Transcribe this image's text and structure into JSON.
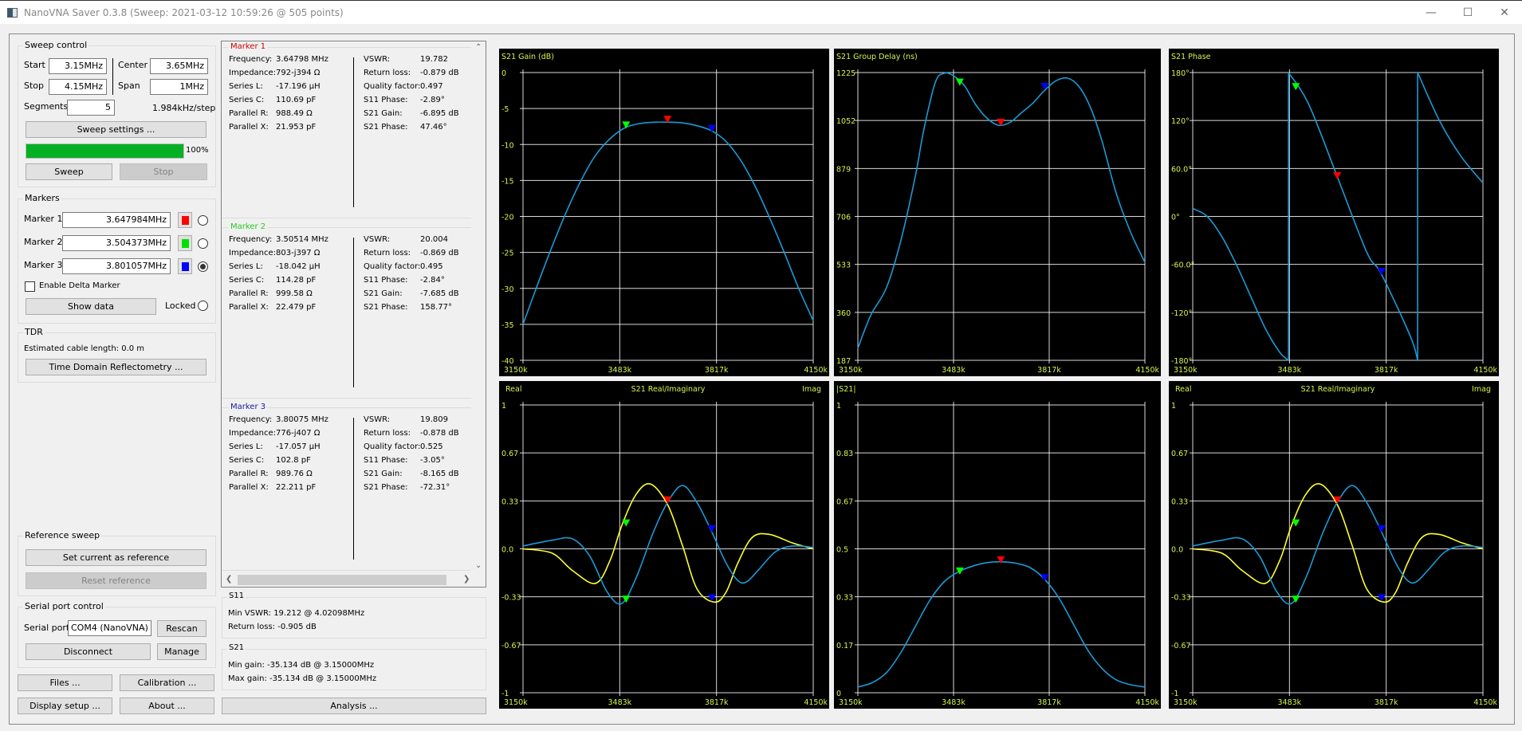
{
  "window": {
    "title": "NanoVNA Saver 0.3.8 (Sweep: 2021-03-12 10:59:26 @ 505 points)",
    "controls": {
      "minimize": "—",
      "maximize": "☐",
      "close": "✕"
    }
  },
  "sweep_control": {
    "title": "Sweep control",
    "start_label": "Start",
    "start_value": "3.15MHz",
    "stop_label": "Stop",
    "stop_value": "4.15MHz",
    "center_label": "Center",
    "center_value": "3.65MHz",
    "span_label": "Span",
    "span_value": "1MHz",
    "segments_label": "Segments",
    "segments_value": "5",
    "step_text": "1.984kHz/step",
    "settings_button": "Sweep settings ...",
    "progress_percent": 100,
    "progress_text": "100%",
    "sweep_button": "Sweep",
    "stop_button": "Stop"
  },
  "markers": {
    "title": "Markers",
    "items": [
      {
        "label": "Marker 1",
        "value": "3.647984MHz",
        "color": "#ff0000",
        "selected": false
      },
      {
        "label": "Marker 2",
        "value": "3.504373MHz",
        "color": "#00e000",
        "selected": false
      },
      {
        "label": "Marker 3",
        "value": "3.801057MHz",
        "color": "#0000ff",
        "selected": true
      }
    ],
    "delta_label": "Enable Delta Marker",
    "show_data_button": "Show data",
    "locked_label": "Locked"
  },
  "tdr": {
    "title": "TDR",
    "cable_length_text": "Estimated cable length:  0.0 m",
    "tdr_button": "Time Domain Reflectometry ..."
  },
  "reference_sweep": {
    "title": "Reference sweep",
    "set_button": "Set current as reference",
    "reset_button": "Reset reference"
  },
  "serial_port": {
    "title": "Serial port control",
    "port_label": "Serial port",
    "port_value": "COM4 (NanoVNA)",
    "rescan_button": "Rescan",
    "disconnect_button": "Disconnect",
    "manage_button": "Manage"
  },
  "bottom_buttons": {
    "files": "Files ...",
    "calibration": "Calibration ...",
    "display_setup": "Display setup ...",
    "about": "About ...",
    "analysis": "Analysis ..."
  },
  "marker_details": [
    {
      "title": "Marker 1",
      "color": "#cc0000",
      "left": [
        [
          "Frequency:",
          "3.64798 MHz"
        ],
        [
          "Impedance:",
          "792-j394 Ω"
        ],
        [
          "Series L:",
          "-17.196 µH"
        ],
        [
          "Series C:",
          "110.69 pF"
        ],
        [
          "Parallel R:",
          "988.49 Ω"
        ],
        [
          "Parallel X:",
          "21.953 pF"
        ]
      ],
      "right": [
        [
          "VSWR:",
          "19.782"
        ],
        [
          "Return loss:",
          "-0.879 dB"
        ],
        [
          "Quality factor:",
          "0.497"
        ],
        [
          "S11 Phase:",
          "-2.89°"
        ],
        [
          "S21 Gain:",
          "-6.895 dB"
        ],
        [
          "S21 Phase:",
          "47.46°"
        ]
      ]
    },
    {
      "title": "Marker 2",
      "color": "#22cc22",
      "left": [
        [
          "Frequency:",
          "3.50514 MHz"
        ],
        [
          "Impedance:",
          "803-j397 Ω"
        ],
        [
          "Series L:",
          "-18.042 µH"
        ],
        [
          "Series C:",
          "114.28 pF"
        ],
        [
          "Parallel R:",
          "999.58 Ω"
        ],
        [
          "Parallel X:",
          "22.479 pF"
        ]
      ],
      "right": [
        [
          "VSWR:",
          "20.004"
        ],
        [
          "Return loss:",
          "-0.869 dB"
        ],
        [
          "Quality factor:",
          "0.495"
        ],
        [
          "S11 Phase:",
          "-2.84°"
        ],
        [
          "S21 Gain:",
          "-7.685 dB"
        ],
        [
          "S21 Phase:",
          "158.77°"
        ]
      ]
    },
    {
      "title": "Marker 3",
      "color": "#1a1aa0",
      "left": [
        [
          "Frequency:",
          "3.80075 MHz"
        ],
        [
          "Impedance:",
          "776-j407 Ω"
        ],
        [
          "Series L:",
          "-17.057 µH"
        ],
        [
          "Series C:",
          "102.8 pF"
        ],
        [
          "Parallel R:",
          "989.76 Ω"
        ],
        [
          "Parallel X:",
          "22.211 pF"
        ]
      ],
      "right": [
        [
          "VSWR:",
          "19.809"
        ],
        [
          "Return loss:",
          "-0.878 dB"
        ],
        [
          "Quality factor:",
          "0.525"
        ],
        [
          "S11 Phase:",
          "-3.05°"
        ],
        [
          "S21 Gain:",
          "-8.165 dB"
        ],
        [
          "S21 Phase:",
          "-72.31°"
        ]
      ]
    }
  ],
  "s11_summary": {
    "title": "S11",
    "min_vswr": "Min VSWR:    19.212 @ 4.02098MHz",
    "return_loss": "Return loss:  -0.905 dB"
  },
  "s21_summary": {
    "title": "S21",
    "min_gain": "Min gain:  -35.134 dB @ 3.15000MHz",
    "max_gain": "Max gain:  -35.134 dB @ 3.15000MHz"
  },
  "colors": {
    "trace": "#1a9ad6",
    "trace_imag": "#ffff30",
    "grid": "#ffffff",
    "chart_text": "#d2f54f",
    "chart_bg": "#000000",
    "marker1": "#ff0000",
    "marker2": "#00ff00",
    "marker3": "#0000ff"
  },
  "chart_data": [
    {
      "type": "line",
      "title": "S21 Gain (dB)",
      "ylabel": "",
      "xlabel": "",
      "x_ticks": [
        "3150k",
        "3483k",
        "3817k",
        "4150k"
      ],
      "xlim": [
        3150,
        4150
      ],
      "y_ticks": [
        "0",
        "-5",
        "-10",
        "-15",
        "-20",
        "-25",
        "-30",
        "-35",
        "-40"
      ],
      "ylim": [
        -40,
        0
      ],
      "series": [
        {
          "name": "S21 Gain",
          "color": "#1a9ad6",
          "x": [
            3150,
            3200,
            3250,
            3300,
            3350,
            3400,
            3450,
            3500,
            3550,
            3600,
            3650,
            3700,
            3750,
            3800,
            3850,
            3900,
            3950,
            4000,
            4050,
            4100,
            4150
          ],
          "y": [
            -35,
            -29.5,
            -24.2,
            -19.3,
            -15,
            -11.5,
            -9.2,
            -7.7,
            -7.1,
            -6.9,
            -6.9,
            -7.0,
            -7.4,
            -8.1,
            -9.6,
            -12.2,
            -15.8,
            -20.2,
            -25.0,
            -30.0,
            -34.5
          ]
        }
      ],
      "markers": [
        {
          "x": 3647.98,
          "y": -6.895,
          "color": "#ff0000"
        },
        {
          "x": 3505.14,
          "y": -7.685,
          "color": "#00ff00"
        },
        {
          "x": 3800.75,
          "y": -8.165,
          "color": "#0000ff"
        }
      ],
      "grid": true
    },
    {
      "type": "line",
      "title": "S21 Group Delay (ns)",
      "ylabel": "",
      "xlabel": "",
      "x_ticks": [
        "3150k",
        "3483k",
        "3817k",
        "4150k"
      ],
      "xlim": [
        3150,
        4150
      ],
      "y_ticks": [
        "1225",
        "1052",
        "879",
        "706",
        "533",
        "360",
        "187"
      ],
      "ylim": [
        187,
        1225
      ],
      "series": [
        {
          "name": "Group Delay",
          "color": "#1a9ad6",
          "x": [
            3150,
            3175,
            3200,
            3250,
            3300,
            3350,
            3380,
            3420,
            3450,
            3480,
            3520,
            3560,
            3600,
            3640,
            3680,
            3720,
            3760,
            3800,
            3840,
            3880,
            3920,
            3960,
            4000,
            4050,
            4100,
            4150
          ],
          "y": [
            230,
            300,
            360,
            450,
            620,
            850,
            1020,
            1190,
            1222,
            1215,
            1180,
            1110,
            1060,
            1035,
            1045,
            1080,
            1115,
            1160,
            1195,
            1205,
            1175,
            1100,
            980,
            790,
            650,
            540
          ]
        }
      ],
      "markers": [
        {
          "x": 3647.98,
          "y": 1035,
          "color": "#ff0000"
        },
        {
          "x": 3505.14,
          "y": 1180,
          "color": "#00ff00"
        },
        {
          "x": 3800.75,
          "y": 1165,
          "color": "#0000ff"
        }
      ],
      "grid": true
    },
    {
      "type": "line",
      "title": "S21 Phase",
      "ylabel": "",
      "xlabel": "",
      "x_ticks": [
        "3150k",
        "3483k",
        "3817k",
        "4150k"
      ],
      "xlim": [
        3150,
        4150
      ],
      "y_ticks": [
        "180°",
        "120°",
        "60.0°",
        "0°",
        "-60.0°",
        "-120°",
        "-180°"
      ],
      "ylim": [
        -180,
        180
      ],
      "series": [
        {
          "name": "S21 Phase",
          "color": "#1a9ad6",
          "segments": [
            {
              "x": [
                3150,
                3200,
                3250,
                3300,
                3350,
                3400,
                3450,
                3480
              ],
              "y": [
                10,
                0,
                -25,
                -60,
                -100,
                -140,
                -170,
                -180
              ]
            },
            {
              "x": [
                3480,
                3480
              ],
              "y": [
                -180,
                180
              ]
            },
            {
              "x": [
                3480,
                3550,
                3650,
                3750,
                3800,
                3900,
                3925
              ],
              "y": [
                180,
                140,
                48,
                -45,
                -72,
                -150,
                -180
              ]
            },
            {
              "x": [
                3925,
                3925
              ],
              "y": [
                -180,
                180
              ]
            },
            {
              "x": [
                3925,
                4000,
                4075,
                4150
              ],
              "y": [
                180,
                120,
                75,
                42
              ]
            }
          ]
        }
      ],
      "markers": [
        {
          "x": 3647.98,
          "y": 47.46,
          "color": "#ff0000"
        },
        {
          "x": 3505.14,
          "y": 158.77,
          "color": "#00ff00"
        },
        {
          "x": 3800.75,
          "y": -72.31,
          "color": "#0000ff"
        }
      ],
      "grid": true
    },
    {
      "type": "line",
      "title": "S21 Real/Imaginary",
      "ylabel": "Real",
      "ylabel_right": "Imag",
      "xlabel": "",
      "x_ticks": [
        "3150k",
        "3483k",
        "3817k",
        "4150k"
      ],
      "xlim": [
        3150,
        4150
      ],
      "y_ticks": [
        "1",
        "0.67",
        "0.33",
        "0.0",
        "-0.33",
        "-0.67",
        "-1"
      ],
      "ylim": [
        -1,
        1
      ],
      "series": [
        {
          "name": "Real",
          "color": "#1a9ad6",
          "x": [
            3150,
            3250,
            3320,
            3380,
            3440,
            3490,
            3540,
            3600,
            3650,
            3700,
            3750,
            3800,
            3850,
            3890,
            3920,
            3960,
            4020,
            4080,
            4150
          ],
          "y": [
            0.02,
            0.06,
            0.07,
            -0.05,
            -0.3,
            -0.38,
            -0.2,
            0.12,
            0.33,
            0.44,
            0.32,
            0.12,
            -0.1,
            -0.22,
            -0.23,
            -0.15,
            -0.02,
            0.02,
            0.01
          ]
        },
        {
          "name": "Imag",
          "color": "#ffff30",
          "x": [
            3150,
            3250,
            3320,
            3400,
            3450,
            3490,
            3540,
            3590,
            3650,
            3700,
            3750,
            3810,
            3850,
            3890,
            3940,
            4000,
            4080,
            4150
          ],
          "y": [
            0.0,
            -0.03,
            -0.15,
            -0.24,
            -0.08,
            0.16,
            0.38,
            0.45,
            0.3,
            0.02,
            -0.28,
            -0.37,
            -0.3,
            -0.1,
            0.08,
            0.1,
            0.04,
            0.0
          ]
        }
      ],
      "markers": [
        {
          "x": 3647.98,
          "y": 0.32,
          "color": "#ff0000"
        },
        {
          "x": 3505.14,
          "y": 0.16,
          "color": "#00ff00"
        },
        {
          "x": 3505.14,
          "y": -0.37,
          "color": "#00ff00"
        },
        {
          "x": 3800.75,
          "y": 0.12,
          "color": "#0000ff"
        },
        {
          "x": 3800.75,
          "y": -0.36,
          "color": "#0000ff"
        }
      ],
      "grid": true
    },
    {
      "type": "line",
      "title": "|S21|",
      "ylabel": "",
      "xlabel": "",
      "x_ticks": [
        "3150k",
        "3483k",
        "3817k",
        "4150k"
      ],
      "xlim": [
        3150,
        4150
      ],
      "y_ticks": [
        "1",
        "0.83",
        "0.67",
        "0.5",
        "0.33",
        "0.17",
        "0"
      ],
      "ylim": [
        0,
        1
      ],
      "series": [
        {
          "name": "|S21|",
          "color": "#1a9ad6",
          "x": [
            3150,
            3200,
            3250,
            3300,
            3350,
            3400,
            3450,
            3500,
            3550,
            3600,
            3650,
            3700,
            3750,
            3800,
            3850,
            3900,
            3950,
            4000,
            4050,
            4100,
            4150
          ],
          "y": [
            0.02,
            0.035,
            0.07,
            0.14,
            0.23,
            0.32,
            0.385,
            0.42,
            0.44,
            0.452,
            0.455,
            0.45,
            0.435,
            0.395,
            0.33,
            0.24,
            0.15,
            0.085,
            0.045,
            0.028,
            0.02
          ]
        }
      ],
      "markers": [
        {
          "x": 3647.98,
          "y": 0.452,
          "color": "#ff0000"
        },
        {
          "x": 3505.14,
          "y": 0.413,
          "color": "#00ff00"
        },
        {
          "x": 3800.75,
          "y": 0.39,
          "color": "#0000ff"
        }
      ],
      "grid": true
    },
    {
      "type": "line",
      "title": "S21 Real/Imaginary",
      "ylabel": "Real",
      "ylabel_right": "Imag",
      "xlabel": "",
      "x_ticks": [
        "3150k",
        "3483k",
        "3817k",
        "4150k"
      ],
      "xlim": [
        3150,
        4150
      ],
      "y_ticks": [
        "1",
        "0.67",
        "0.33",
        "0.0",
        "-0.33",
        "-0.67",
        "-1"
      ],
      "ylim": [
        -1,
        1
      ],
      "series": [
        {
          "name": "Real",
          "color": "#1a9ad6",
          "x": [
            3150,
            3250,
            3320,
            3380,
            3440,
            3490,
            3540,
            3600,
            3650,
            3700,
            3750,
            3800,
            3850,
            3890,
            3920,
            3960,
            4020,
            4080,
            4150
          ],
          "y": [
            0.02,
            0.06,
            0.07,
            -0.05,
            -0.3,
            -0.38,
            -0.2,
            0.12,
            0.33,
            0.44,
            0.32,
            0.12,
            -0.1,
            -0.22,
            -0.23,
            -0.15,
            -0.02,
            0.02,
            0.01
          ]
        },
        {
          "name": "Imag",
          "color": "#ffff30",
          "x": [
            3150,
            3250,
            3320,
            3400,
            3450,
            3490,
            3540,
            3590,
            3650,
            3700,
            3750,
            3810,
            3850,
            3890,
            3940,
            4000,
            4080,
            4150
          ],
          "y": [
            0.0,
            -0.03,
            -0.15,
            -0.24,
            -0.08,
            0.16,
            0.38,
            0.45,
            0.3,
            0.02,
            -0.28,
            -0.37,
            -0.3,
            -0.1,
            0.08,
            0.1,
            0.04,
            0.0
          ]
        }
      ],
      "markers": [
        {
          "x": 3647.98,
          "y": 0.32,
          "color": "#ff0000"
        },
        {
          "x": 3505.14,
          "y": 0.16,
          "color": "#00ff00"
        },
        {
          "x": 3505.14,
          "y": -0.37,
          "color": "#00ff00"
        },
        {
          "x": 3800.75,
          "y": 0.12,
          "color": "#0000ff"
        },
        {
          "x": 3800.75,
          "y": -0.36,
          "color": "#0000ff"
        }
      ],
      "grid": true
    }
  ]
}
